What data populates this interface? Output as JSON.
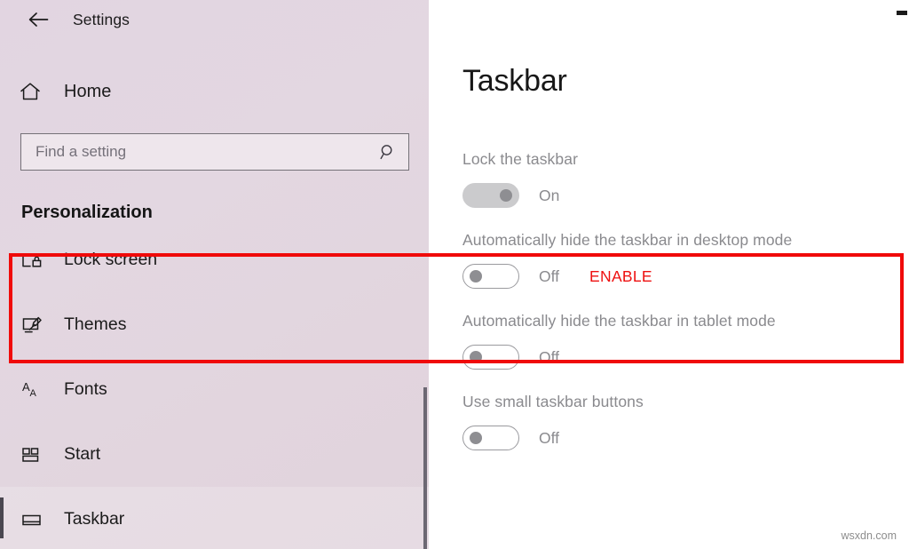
{
  "window": {
    "app_title": "Settings",
    "back_icon": "back-arrow-icon",
    "minimize_icon": "minimize-icon"
  },
  "sidebar": {
    "home": {
      "label": "Home",
      "icon": "home-icon"
    },
    "search": {
      "placeholder": "Find a setting",
      "value": "",
      "icon": "search-icon"
    },
    "section_header": "Personalization",
    "items": [
      {
        "label": "Lock screen",
        "icon": "lock-screen-icon",
        "selected": false
      },
      {
        "label": "Themes",
        "icon": "themes-icon",
        "selected": false
      },
      {
        "label": "Fonts",
        "icon": "fonts-icon",
        "selected": false
      },
      {
        "label": "Start",
        "icon": "start-icon",
        "selected": false
      },
      {
        "label": "Taskbar",
        "icon": "taskbar-icon",
        "selected": true
      }
    ]
  },
  "main": {
    "page_title": "Taskbar",
    "settings": [
      {
        "title": "Lock the taskbar",
        "state": "On",
        "toggle_on": true,
        "action": ""
      },
      {
        "title": "Automatically hide the taskbar in desktop mode",
        "state": "Off",
        "toggle_on": false,
        "action": "ENABLE"
      },
      {
        "title": "Automatically hide the taskbar in tablet mode",
        "state": "Off",
        "toggle_on": false,
        "action": ""
      },
      {
        "title": "Use small taskbar buttons",
        "state": "Off",
        "toggle_on": false,
        "action": ""
      }
    ]
  },
  "annotation": {
    "highlight_color": "#f00a0a",
    "action_color": "#ee1111"
  },
  "watermark": "wsxdn.com"
}
